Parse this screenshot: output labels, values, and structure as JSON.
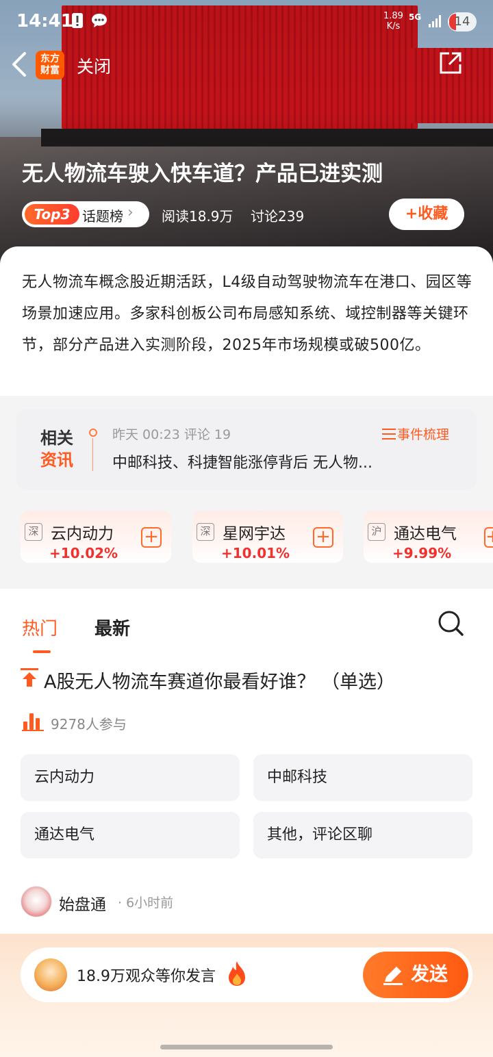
{
  "status_bar": {
    "time": "14:41",
    "net_speed_value": "1.89",
    "net_speed_unit": "K/s",
    "network": "5G",
    "battery": "14"
  },
  "nav": {
    "logo_line1": "东方",
    "logo_line2": "财富",
    "close_label": "关闭"
  },
  "topic": {
    "title": "无人物流车驶入快车道？产品已进实测",
    "rank_badge": "Top3",
    "rank_label": "话题榜",
    "reads": "阅读18.9万",
    "comments": "讨论239",
    "favorite_label": "收藏",
    "summary": "无人物流车概念股近期活跃，L4级自动驾驶物流车在港口、园区等场景加速应用。多家科创板公司布局感知系统、域控制器等关键环节，部分产品进入实测阶段，2025年市场规模或破500亿。"
  },
  "related_news": {
    "badge_line1": "相关",
    "badge_line2": "资讯",
    "time": "昨天 00:23 评论 19",
    "events_label": "事件梳理",
    "headline": "中邮科技、科捷智能涨停背后 无人物..."
  },
  "stocks": [
    {
      "exchange": "深",
      "name": "云内动力",
      "change": "+10.02%"
    },
    {
      "exchange": "深",
      "name": "星网宇达",
      "change": "+10.01%"
    },
    {
      "exchange": "沪",
      "name": "通达电气",
      "change": "+9.99%"
    }
  ],
  "tabs": {
    "hot": "热门",
    "latest": "最新"
  },
  "poll": {
    "question": "A股无人物流车赛道你最看好谁？ （单选）",
    "participants": "9278人参与",
    "options": [
      "云内动力",
      "中邮科技",
      "通达电气",
      "其他，评论区聊"
    ]
  },
  "post": {
    "author": "始盘通",
    "time": "· 6小时前"
  },
  "bottom_bar": {
    "placeholder": "18.9万观众等你发言",
    "send_label": "发送"
  },
  "colors": {
    "accent": "#ff5a1f",
    "rise": "#f0312d"
  }
}
